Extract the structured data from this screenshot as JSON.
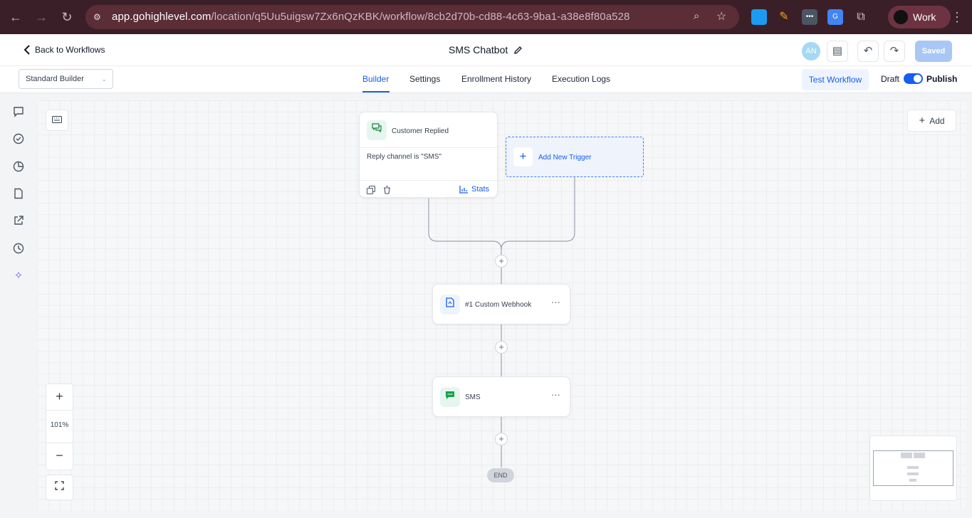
{
  "browser": {
    "url_host": "app.gohighlevel.com",
    "url_path": "/location/q5Uu5uigsw7Zx6nQzKBK/workflow/8cb2d70b-cd88-4c63-9ba1-a38e8f80a528",
    "profile_label": "Work"
  },
  "header": {
    "back_label": "Back to Workflows",
    "title": "SMS Chatbot",
    "avatar_initials": "AN",
    "saved_label": "Saved"
  },
  "subnav": {
    "builder_select_value": "Standard Builder",
    "tabs": [
      {
        "label": "Builder",
        "active": true
      },
      {
        "label": "Settings",
        "active": false
      },
      {
        "label": "Enrollment History",
        "active": false
      },
      {
        "label": "Execution Logs",
        "active": false
      }
    ],
    "test_workflow_label": "Test Workflow",
    "draft_label": "Draft",
    "publish_label": "Publish",
    "publish_toggle_on": true
  },
  "canvas": {
    "add_label": "Add",
    "trigger": {
      "title": "Customer Replied",
      "condition": "Reply channel is \"SMS\"",
      "stats_label": "Stats"
    },
    "add_trigger_label": "Add New Trigger",
    "actions": [
      {
        "title": "#1 Custom Webhook",
        "icon": "webhook-doc-icon"
      },
      {
        "title": "SMS",
        "icon": "sms-chat-icon"
      }
    ],
    "end_label": "END",
    "zoom_level": "101%"
  },
  "colors": {
    "accent": "#155eef",
    "chrome_bg": "#3b1f28",
    "sms_icon": "#16a34a"
  }
}
